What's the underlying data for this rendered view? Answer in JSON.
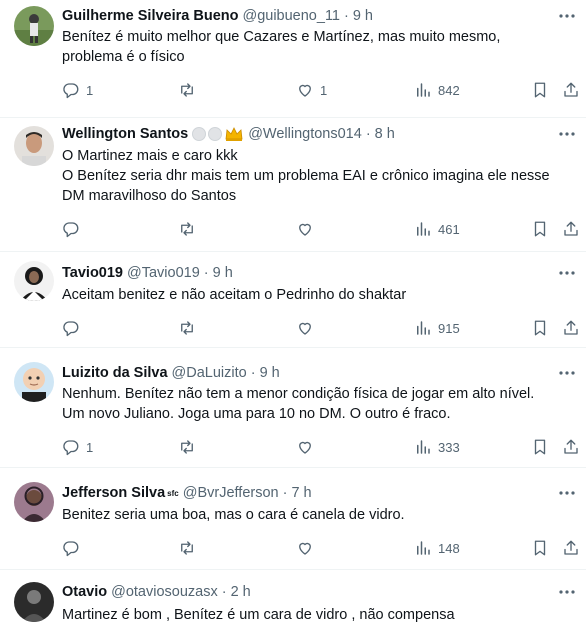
{
  "tweets": [
    {
      "name": "Guilherme Silveira Bueno",
      "handle": "@guibueno_11",
      "time": "9 h",
      "lines": [
        "Benítez é muito melhor que Cazares e Martínez, mas muito mesmo,",
        "problema é o físico"
      ],
      "replies": "1",
      "retweets": "",
      "likes": "1",
      "views": "842"
    },
    {
      "name": "Wellington Santos",
      "handle": "@Wellingtons014",
      "time": "8 h",
      "lines": [
        "O Martinez mais e caro kkk",
        "O Benítez seria dhr mais tem um problema EAI e crônico imagina ele nesse",
        "DM maravilhoso do Santos"
      ],
      "replies": "",
      "retweets": "",
      "likes": "",
      "views": "461"
    },
    {
      "name": "Tavio019",
      "handle": "@Tavio019",
      "time": "9 h",
      "lines": [
        "Aceitam benitez e não aceitam o Pedrinho do shaktar"
      ],
      "replies": "",
      "retweets": "",
      "likes": "",
      "views": "915"
    },
    {
      "name": "Luizito da Silva",
      "handle": "@DaLuizito",
      "time": "9 h",
      "lines": [
        "Nenhum. Benítez não tem a menor condição física de jogar em alto nível.",
        "Um novo Juliano. Joga uma para 10 no DM. O outro é fraco."
      ],
      "replies": "1",
      "retweets": "",
      "likes": "",
      "views": "333"
    },
    {
      "name": "Jefferson Silva",
      "name_suffix": "sfc",
      "handle": "@BvrJefferson",
      "time": "7 h",
      "lines": [
        "Benitez seria uma boa, mas o cara é canela de vidro."
      ],
      "replies": "",
      "retweets": "",
      "likes": "",
      "views": "148"
    },
    {
      "name": "Otavio",
      "handle": "@otaviosouzasx",
      "time": "2 h",
      "lines": [
        "Martinez é bom , Benítez é um cara de vidro , não compensa"
      ]
    }
  ],
  "separator": "·",
  "icons": {
    "reply": "reply-icon",
    "retweet": "retweet-icon",
    "like": "heart-icon",
    "views": "views-chart-icon",
    "bookmark": "bookmark-icon",
    "share": "share-icon",
    "more": "more-options-icon"
  },
  "colors": {
    "text": "#0f1419",
    "secondary": "#536471",
    "divider": "#eff3f4",
    "badge_gold": "#f4b400"
  }
}
